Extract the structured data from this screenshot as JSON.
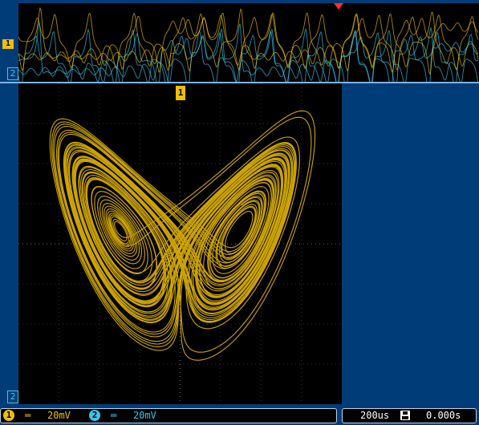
{
  "display": {
    "mode": "XY",
    "ch1_marker": "1",
    "ch2_marker": "2",
    "ch1_color": "#f0c000",
    "ch2_color": "#38c8f0",
    "trigger_marker_color": "#ff3030",
    "grid_divisions": {
      "horizontal": 8,
      "vertical": 8
    }
  },
  "status": {
    "ch1": {
      "number": "1",
      "coupling_icon": "dc-coupling-icon",
      "coupling_symbol": "═",
      "scale": "20mV"
    },
    "ch2": {
      "number": "2",
      "coupling_icon": "dc-coupling-icon",
      "coupling_symbol": "═",
      "scale": "20mV"
    },
    "timebase": "200us",
    "save_icon": "floppy-icon",
    "trigger_time": "0.000s"
  }
}
